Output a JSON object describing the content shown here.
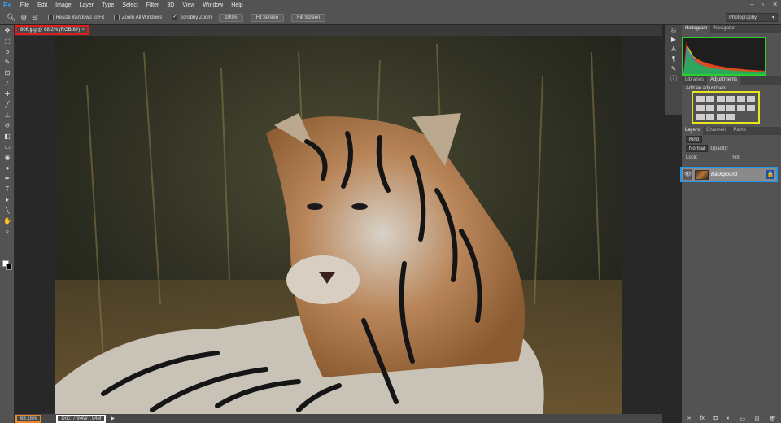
{
  "app": {
    "logo": "Ps"
  },
  "menu": [
    "File",
    "Edit",
    "Image",
    "Layer",
    "Type",
    "Select",
    "Filter",
    "3D",
    "View",
    "Window",
    "Help"
  ],
  "window_controls": {
    "minimize": "–",
    "restore": "▫",
    "close": "✕"
  },
  "options": {
    "resize_windows": {
      "label": "Resize Windows to Fit",
      "checked": false
    },
    "zoom_all": {
      "label": "Zoom All Windows",
      "checked": false
    },
    "scrubby": {
      "label": "Scrubby Zoom",
      "checked": true
    },
    "btn_100": "100%",
    "btn_fit": "Fit Screen",
    "btn_fill": "Fill Screen",
    "workspace": "Photography"
  },
  "document": {
    "tab_title": "806.jpg @ 68.2% (RGB/8#)",
    "close": "×"
  },
  "status": {
    "zoom": "68.16%",
    "doc": "Doc: 7.94M/7.94M"
  },
  "panels": {
    "histogram_tabs": [
      "Histogram",
      "Navigator"
    ],
    "adjust_tabs": [
      "Libraries",
      "Adjustments"
    ],
    "adjust_title": "Add an adjustment",
    "layer_tabs": [
      "Layers",
      "Channels",
      "Paths"
    ],
    "kind_label": "Kind",
    "blend_mode": "Normal",
    "opacity_label": "Opacity:",
    "lock_label": "Lock:",
    "fill_label": "Fill:",
    "layer_name": "Background"
  },
  "icons": {
    "zoom_tool": "zoom-icon",
    "eye": "eye-icon",
    "lock": "lock-icon"
  }
}
